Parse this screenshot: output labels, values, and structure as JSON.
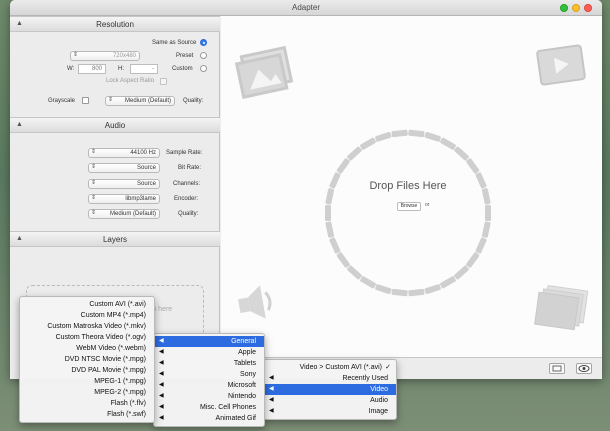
{
  "window": {
    "title": "Adapter"
  },
  "resolution": {
    "header": "Resolution",
    "same_as_source": "Same as Source",
    "preset": "Preset",
    "preset_value": "720x480",
    "custom": "Custom",
    "w_label": "W:",
    "w_value": "800",
    "h_label": "H:",
    "h_value": "-",
    "lock_aspect": "Lock Aspect Ratio",
    "quality_label": "Quality:",
    "quality_value": "Medium (Default)",
    "grayscale": "Grayscale"
  },
  "audio": {
    "header": "Audio",
    "sample_rate_label": "Sample Rate:",
    "sample_rate_value": "44100 Hz",
    "bit_rate_label": "Bit Rate:",
    "bit_rate_value": "Source",
    "channels_label": "Channels:",
    "channels_value": "Source",
    "encoder_label": "Encoder:",
    "encoder_value": "libmp3lame",
    "quality_label": "Quality:",
    "quality_value": "Medium (Default)"
  },
  "layers": {
    "header": "Layers",
    "drop_hint": "Drop subtitles, images, or audio here"
  },
  "main": {
    "drop_text": "Drop Files Here",
    "or": "or",
    "browse": "Browse"
  },
  "menus": {
    "root": [
      {
        "label": "Video > Custom AVI (*.avi)",
        "checked": true
      },
      {
        "label": "Recently Used",
        "submenu": true
      },
      {
        "label": "Video",
        "submenu": true,
        "selected": true
      },
      {
        "label": "Audio",
        "submenu": true
      },
      {
        "label": "Image",
        "submenu": true
      }
    ],
    "video": [
      {
        "label": "General",
        "selected": true
      },
      {
        "label": "Apple"
      },
      {
        "label": "Tablets"
      },
      {
        "label": "Sony"
      },
      {
        "label": "Microsoft"
      },
      {
        "label": "Nintendo"
      },
      {
        "label": "Misc. Cell Phones"
      },
      {
        "label": "Animated Gif"
      }
    ],
    "general": [
      "Custom AVI (*.avi)",
      "Custom MP4 (*.mp4)",
      "Custom Matroska Video (*.mkv)",
      "Custom Theora Video (*.ogv)",
      "WebM Video (*.webm)",
      "DVD NTSC Movie (*.mpg)",
      "DVD PAL Movie (*.mpg)",
      "MPEG-1 (*.mpg)",
      "MPEG-2 (*.mpg)",
      "Flash (*.flv)",
      "Flash (*.swf)"
    ]
  },
  "colors": {
    "accent": "#2d6ce0",
    "close": "#fb5f57",
    "minimize": "#fbbf2e",
    "zoom": "#32c03f"
  }
}
